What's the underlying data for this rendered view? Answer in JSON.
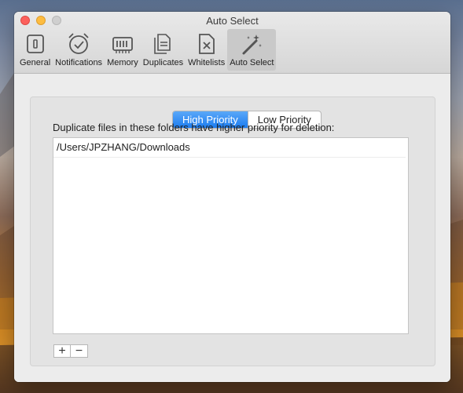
{
  "window": {
    "title": "Auto Select"
  },
  "toolbar": {
    "items": [
      {
        "label": "General",
        "icon": "general-icon"
      },
      {
        "label": "Notifications",
        "icon": "alarm-clock-icon"
      },
      {
        "label": "Memory",
        "icon": "memory-chip-icon"
      },
      {
        "label": "Duplicates",
        "icon": "duplicate-files-icon"
      },
      {
        "label": "Whitelists",
        "icon": "whitelist-file-icon"
      },
      {
        "label": "Auto Select",
        "icon": "magic-wand-icon"
      }
    ],
    "selected": "Auto Select"
  },
  "segmented": {
    "options": [
      "High Priority",
      "Low Priority"
    ],
    "selected": "High Priority"
  },
  "description": "Duplicate files in these folders have higher priority for deletion:",
  "folders": [
    "/Users/JPZHANG/Downloads"
  ],
  "buttons": {
    "add": "+",
    "remove": "−"
  },
  "colors": {
    "accent": "#1b7cf0",
    "close": "#fc605c",
    "minimize": "#fdbc40"
  }
}
